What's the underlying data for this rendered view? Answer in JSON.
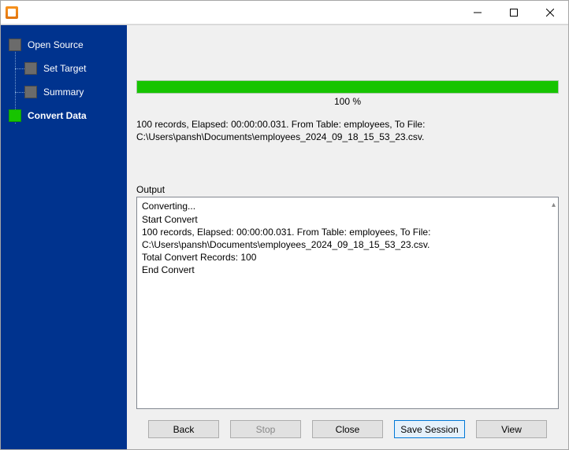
{
  "window": {
    "title": ""
  },
  "sidebar": {
    "steps": [
      {
        "label": "Open Source",
        "active": false
      },
      {
        "label": "Set Target",
        "active": false
      },
      {
        "label": "Summary",
        "active": false
      },
      {
        "label": "Convert Data",
        "active": true
      }
    ]
  },
  "progress": {
    "percent": 100,
    "label": "100 %"
  },
  "status_line": "100 records,    Elapsed: 00:00:00.031.    From Table: employees,    To File: C:\\Users\\pansh\\Documents\\employees_2024_09_18_15_53_23.csv.",
  "output": {
    "label": "Output",
    "lines": [
      "Converting...",
      "Start Convert",
      "100 records,    Elapsed: 00:00:00.031.    From Table: employees,    To File: C:\\Users\\pansh\\Documents\\employees_2024_09_18_15_53_23.csv.",
      "Total Convert Records: 100",
      "End Convert"
    ]
  },
  "buttons": {
    "back": "Back",
    "stop": "Stop",
    "close": "Close",
    "save_session": "Save Session",
    "view": "View"
  }
}
